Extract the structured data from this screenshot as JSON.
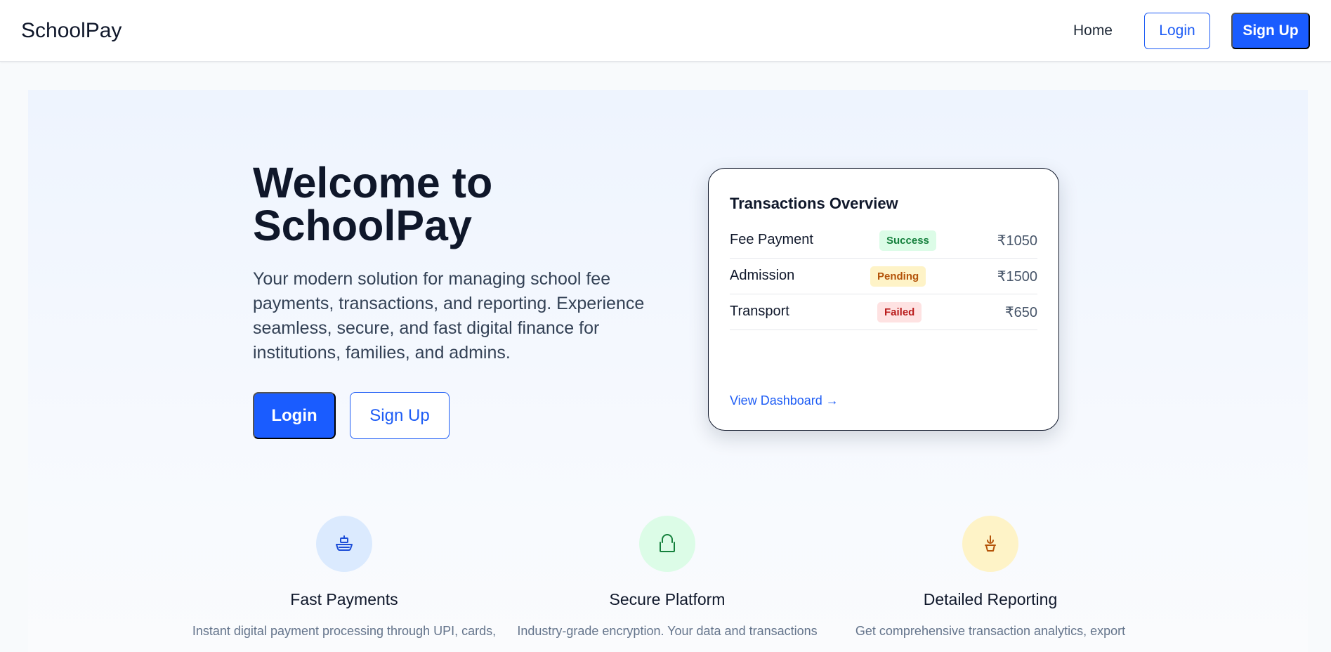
{
  "navbar": {
    "brand": "SchoolPay",
    "home": "Home",
    "login": "Login",
    "signup": "Sign Up"
  },
  "hero": {
    "title": "Welcome to SchoolPay",
    "subtitle": "Your modern solution for managing school fee payments, transactions, and reporting. Experience seamless, secure, and fast digital finance for institutions, families, and admins.",
    "login": "Login",
    "signup": "Sign Up"
  },
  "transactions": {
    "title": "Transactions Overview",
    "rows": [
      {
        "name": "Fee Payment",
        "status": "Success",
        "amount": "₹1050"
      },
      {
        "name": "Admission",
        "status": "Pending",
        "amount": "₹1500"
      },
      {
        "name": "Transport",
        "status": "Failed",
        "amount": "₹650"
      }
    ],
    "link": "View Dashboard →"
  },
  "features": [
    {
      "icon": "payment-icon",
      "title": "Fast Payments",
      "desc": "Instant digital payment processing through UPI, cards,"
    },
    {
      "icon": "lock-icon",
      "title": "Secure Platform",
      "desc": "Industry-grade encryption. Your data and transactions"
    },
    {
      "icon": "report-icon",
      "title": "Detailed Reporting",
      "desc": "Get comprehensive transaction analytics, export"
    }
  ],
  "colors": {
    "primary": "#1a5cff",
    "success_bg": "#dcfce7",
    "success_text": "#15803d",
    "pending_bg": "#fef3c7",
    "pending_text": "#b45309",
    "failed_bg": "#fee2e2",
    "failed_text": "#b91c1c"
  }
}
